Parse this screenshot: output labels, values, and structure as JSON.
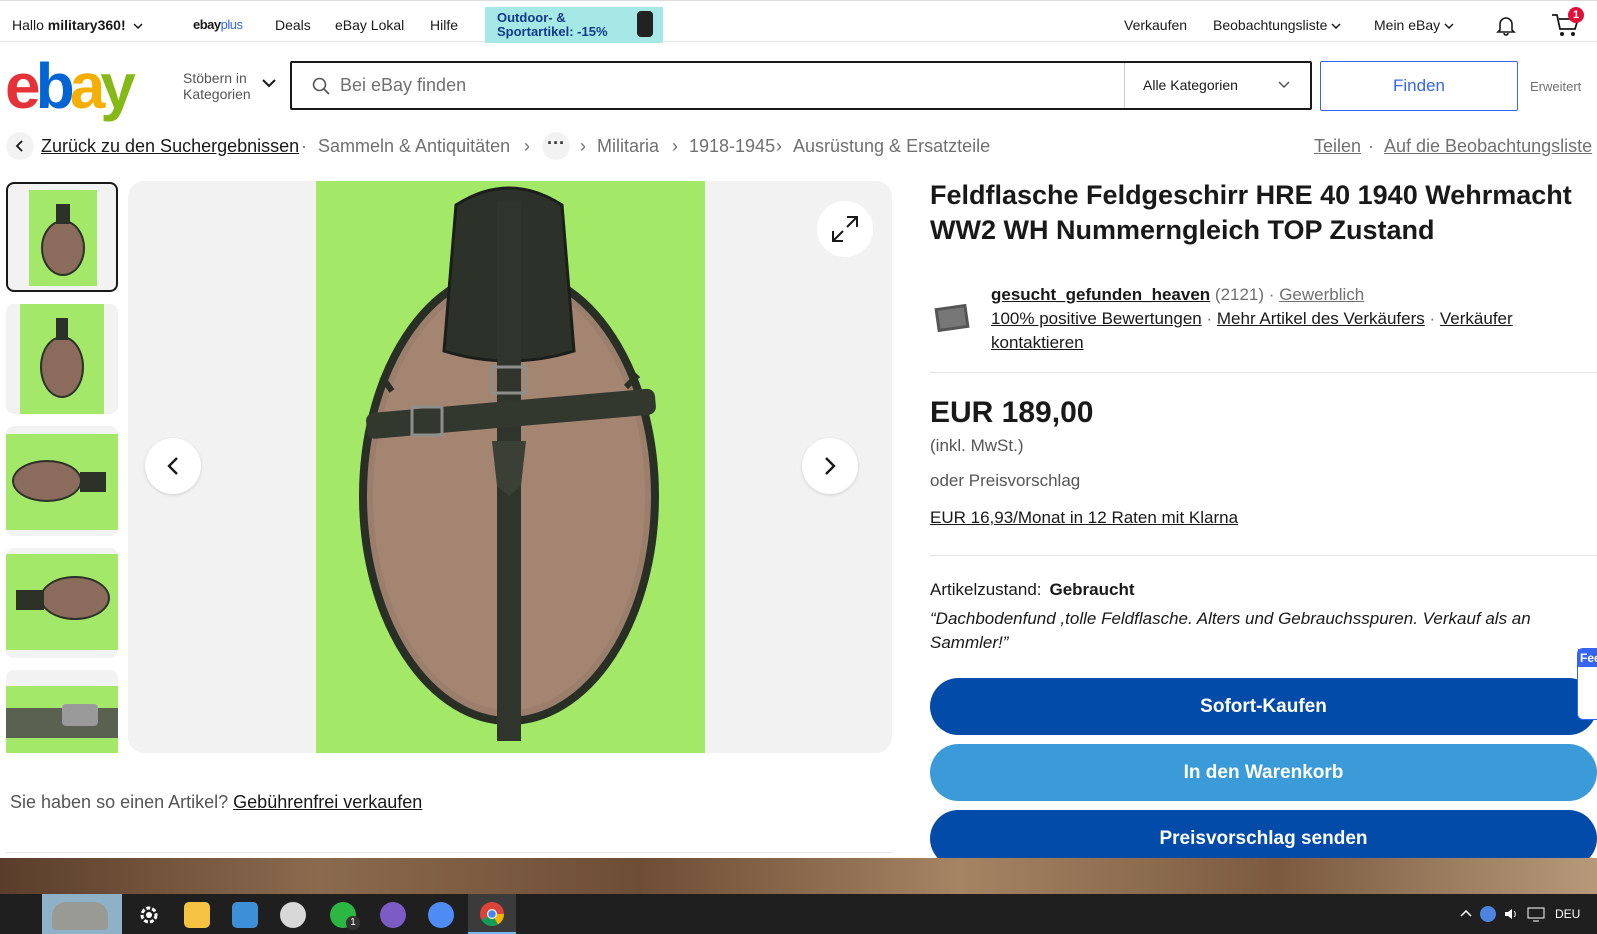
{
  "topbar": {
    "greeting_prefix": "Hallo ",
    "user": "military360!",
    "ebayplus_a": "ebay",
    "ebayplus_b": "plus",
    "deals": "Deals",
    "lokal": "eBay Lokal",
    "hilfe": "Hilfe",
    "promo_line1": "Outdoor- &",
    "promo_line2": "Sportartikel: -15%",
    "verkaufen": "Verkaufen",
    "watchlist": "Beobachtungsliste",
    "mein_ebay": "Mein eBay",
    "cart_count": "1"
  },
  "header": {
    "logo_e": "e",
    "logo_b": "b",
    "logo_a": "a",
    "logo_y": "y",
    "browse_line1": "Stöbern in",
    "browse_line2": "Kategorien",
    "search_placeholder": "Bei eBay finden",
    "category": "Alle Kategorien",
    "find": "Finden",
    "advanced": "Erweitert"
  },
  "breadcrumb": {
    "back": "Zurück zu den Suchergebnissen",
    "dot": "·",
    "sep": "›",
    "c1": "Sammeln & Antiquitäten",
    "more": "···",
    "c2": "Militaria",
    "c3": "1918-1945",
    "c4": "Ausrüstung & Ersatzteile",
    "share": "Teilen",
    "watch": "Auf die Beobachtungsliste"
  },
  "sell": {
    "question": "Sie haben so einen Artikel?",
    "link": "Gebührenfrei verkaufen"
  },
  "item": {
    "title": "Feldflasche Feldgeschirr HRE 40 1940 Wehrmacht WW2 WH Nummerngleich TOP Zustand",
    "seller_name": "gesucht_gefunden_heaven",
    "seller_count": "(2121)",
    "sep": "·",
    "seller_type": "Gewerblich",
    "positive": "100% positive Bewertungen",
    "more_items": "Mehr Artikel des Verkäufers",
    "contact": "Verkäufer kontaktieren",
    "price": "EUR 189,00",
    "vat": "(inkl. MwSt.)",
    "offer": "oder Preisvorschlag",
    "klarna": "EUR 16,93/Monat in 12 Raten mit Klarna",
    "condition_label": "Artikelzustand:",
    "condition_value": "Gebraucht",
    "condition_quote": "“Dachbodenfund ,tolle Feldflasche. Alters und Gebrauchsspuren. Verkauf als an Sammler!”",
    "buy_now": "Sofort-Kaufen",
    "add_cart": "In den Warenkorb",
    "make_offer": "Preisvorschlag senden",
    "feedback": "Fee"
  },
  "taskbar": {
    "lang": "DEU",
    "whatsapp_badge": "1"
  },
  "colors": {
    "primary_blue": "#024ba8",
    "secondary_blue": "#3a9bd8",
    "photo_background": "#a3e867"
  }
}
